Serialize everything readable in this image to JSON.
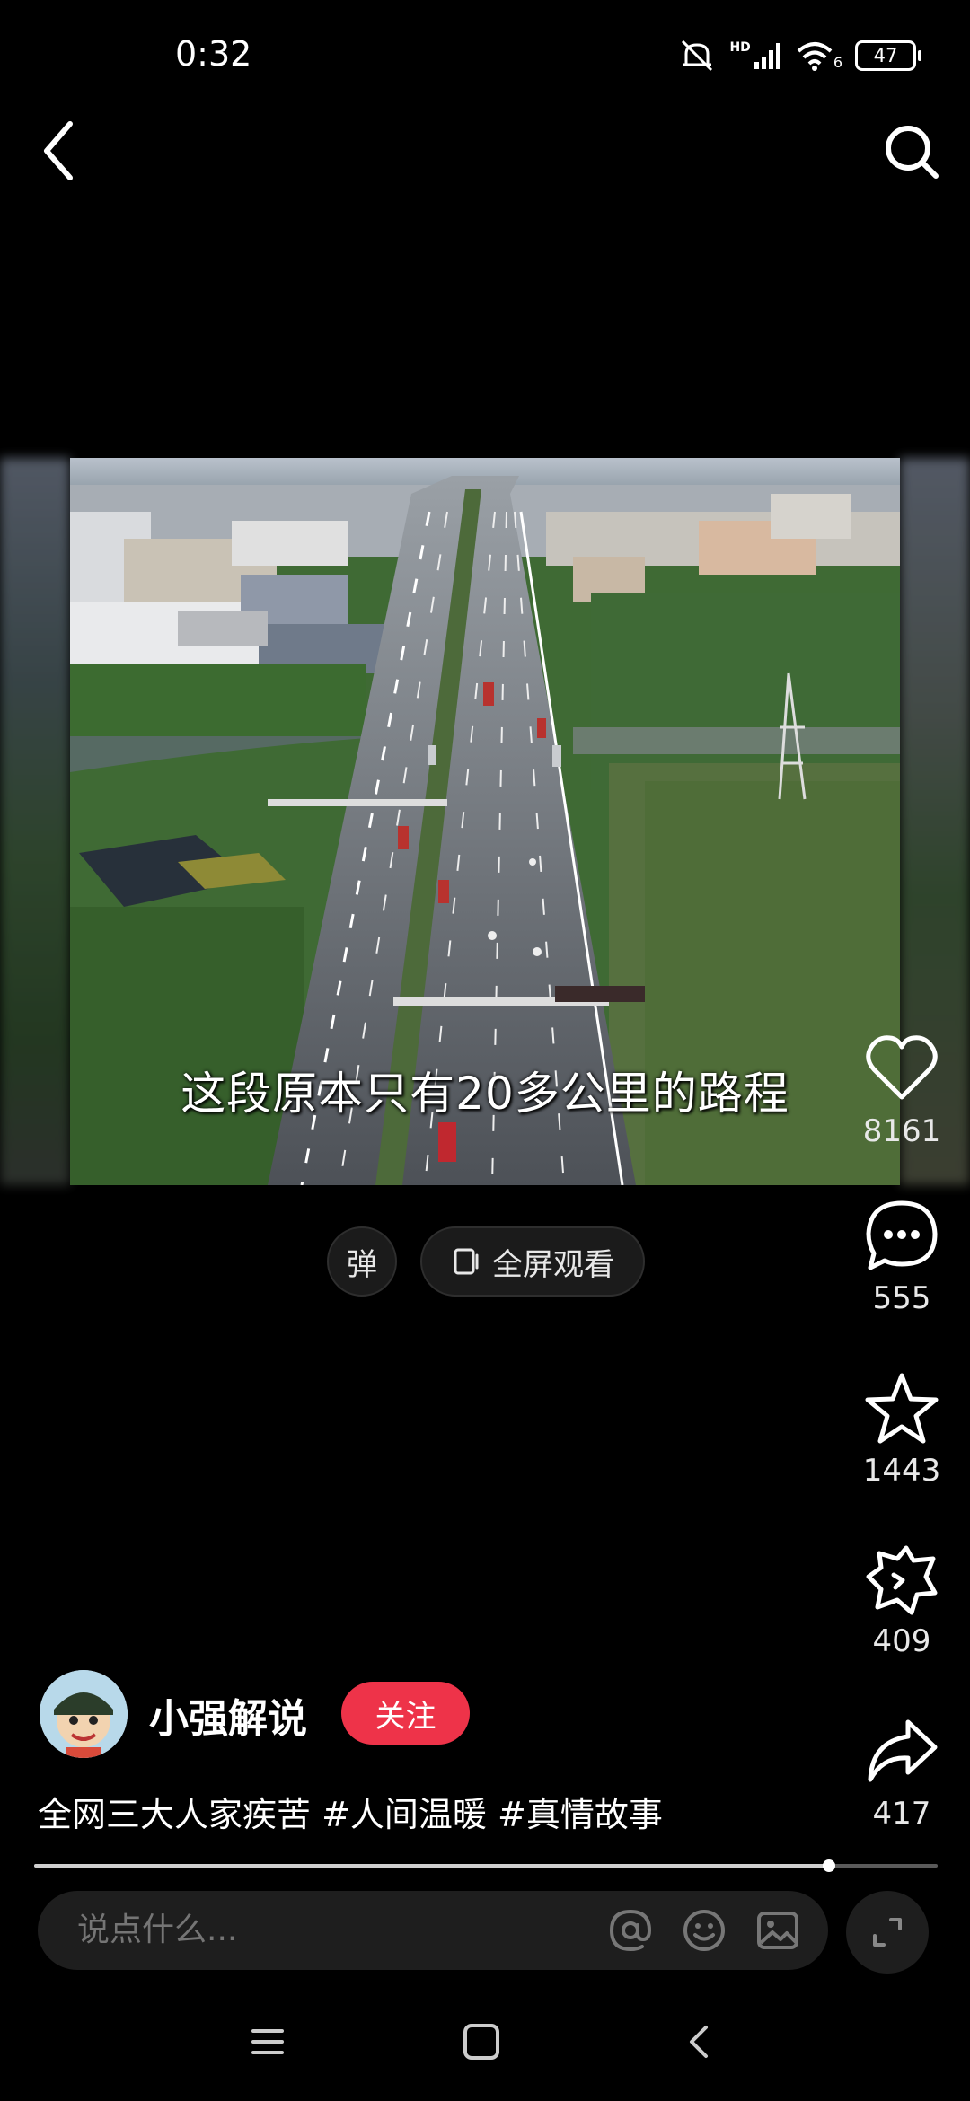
{
  "status_bar": {
    "time": "0:32",
    "hd_label": "HD",
    "wifi_label": "6",
    "battery": "47",
    "icons": [
      "mute-icon",
      "signal-icon",
      "wifi-icon",
      "battery-icon"
    ]
  },
  "nav": {
    "back_icon": "chevron-left-icon",
    "search_icon": "search-icon"
  },
  "video": {
    "subtitle": "这段原本只有20多公里的路程"
  },
  "controls": {
    "danmaku_label": "弹",
    "fullscreen_label": "全屏观看"
  },
  "actions": {
    "like_count": "8161",
    "comment_count": "555",
    "collect_count": "1443",
    "gift_count": "409",
    "share_count": "417"
  },
  "author": {
    "name": "小强解说",
    "follow_label": "关注"
  },
  "caption": "全网三大人家疾苦 #人间温暖 #真情故事",
  "progress": {
    "fraction": 0.88
  },
  "comment_bar": {
    "placeholder": "说点什么..."
  },
  "colors": {
    "accent": "#ee3349",
    "background": "#000000"
  }
}
